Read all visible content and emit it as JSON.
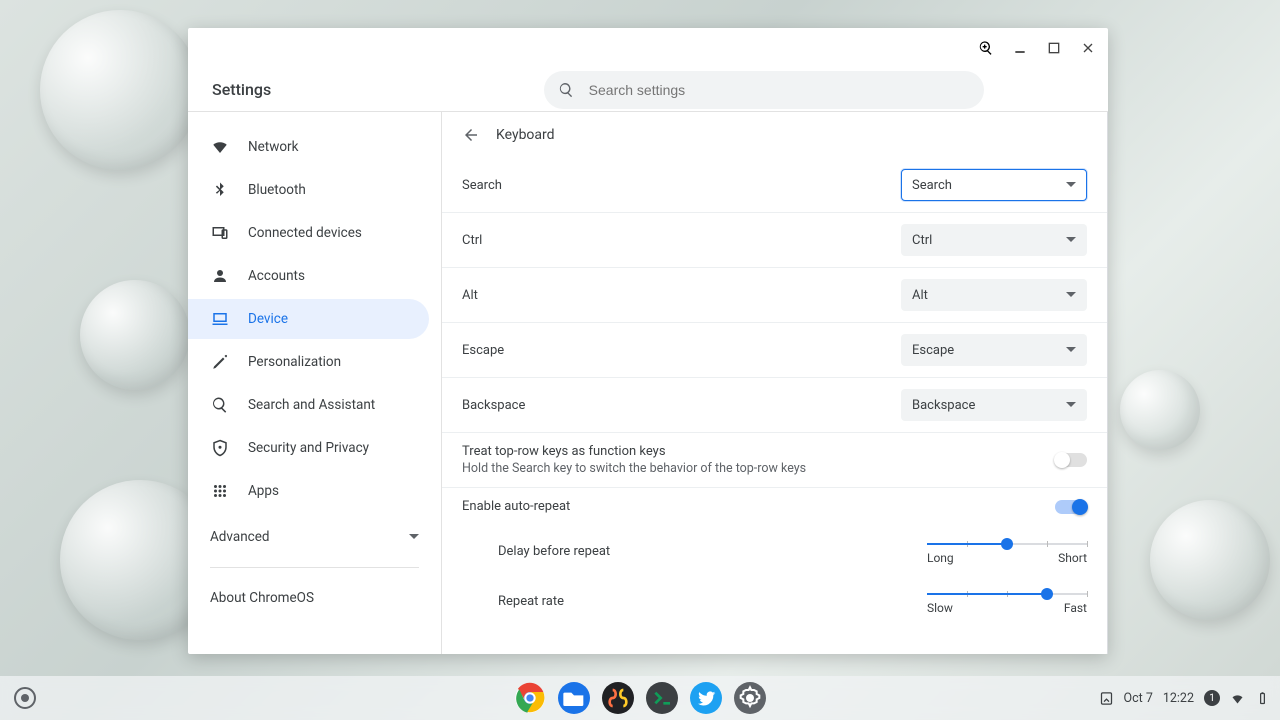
{
  "app": {
    "title": "Settings"
  },
  "search": {
    "placeholder": "Search settings"
  },
  "sidebar": {
    "items": [
      {
        "label": "Network",
        "icon": "wifi"
      },
      {
        "label": "Bluetooth",
        "icon": "bluetooth"
      },
      {
        "label": "Connected devices",
        "icon": "devices"
      },
      {
        "label": "Accounts",
        "icon": "account"
      },
      {
        "label": "Device",
        "icon": "laptop",
        "active": true
      },
      {
        "label": "Personalization",
        "icon": "pen"
      },
      {
        "label": "Search and Assistant",
        "icon": "search"
      },
      {
        "label": "Security and Privacy",
        "icon": "shield"
      },
      {
        "label": "Apps",
        "icon": "apps"
      }
    ],
    "advanced": "Advanced",
    "about": "About ChromeOS"
  },
  "page": {
    "title": "Keyboard",
    "keys": [
      {
        "label": "Search",
        "value": "Search",
        "focused": true
      },
      {
        "label": "Ctrl",
        "value": "Ctrl"
      },
      {
        "label": "Alt",
        "value": "Alt"
      },
      {
        "label": "Escape",
        "value": "Escape"
      },
      {
        "label": "Backspace",
        "value": "Backspace"
      }
    ],
    "toprow": {
      "title": "Treat top-row keys as function keys",
      "sub": "Hold the Search key to switch the behavior of the top-row keys",
      "on": false
    },
    "autorepeat": {
      "title": "Enable auto-repeat",
      "on": true
    },
    "sliders": {
      "delay": {
        "label": "Delay before repeat",
        "left": "Long",
        "right": "Short",
        "pct": 50
      },
      "rate": {
        "label": "Repeat rate",
        "left": "Slow",
        "right": "Fast",
        "pct": 75
      }
    }
  },
  "shelf": {
    "apps": [
      {
        "name": "chrome",
        "bg": "#fff"
      },
      {
        "name": "files",
        "bg": "#1a73e8"
      },
      {
        "name": "media",
        "bg": "#202124"
      },
      {
        "name": "terminal",
        "bg": "#3c4043"
      },
      {
        "name": "twitter",
        "bg": "#1da1f2"
      },
      {
        "name": "settings",
        "bg": "#5f6368"
      }
    ],
    "tray": {
      "date": "Oct 7",
      "time": "12:22",
      "notifications": "1"
    }
  }
}
